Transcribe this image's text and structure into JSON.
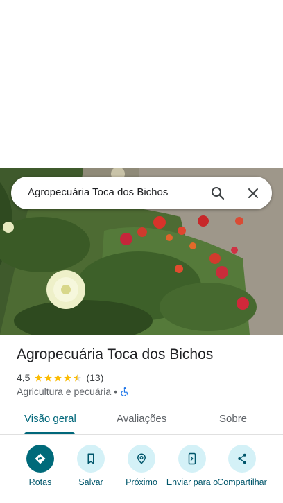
{
  "search": {
    "query": "Agropecuária Toca dos Bichos"
  },
  "place": {
    "name": "Agropecuária Toca dos Bichos",
    "rating": "4,5",
    "review_count": "(13)",
    "stars": 4.5,
    "category": "Agricultura e pecuária",
    "separator": "•"
  },
  "tabs": [
    {
      "label": "Visão geral",
      "active": true
    },
    {
      "label": "Avaliações",
      "active": false
    },
    {
      "label": "Sobre",
      "active": false
    }
  ],
  "actions": [
    {
      "label": "Rotas",
      "icon": "directions-icon"
    },
    {
      "label": "Salvar",
      "icon": "bookmark-icon"
    },
    {
      "label": "Próximo",
      "icon": "nearby-icon"
    },
    {
      "label": "Enviar para o",
      "icon": "send-to-phone-icon"
    },
    {
      "label": "Compartilhar",
      "icon": "share-icon"
    }
  ],
  "colors": {
    "accent": "#00677a",
    "accent_light": "#d4f1f7",
    "star": "#fbbc04",
    "text": "#202124",
    "secondary_text": "#5f6368"
  }
}
